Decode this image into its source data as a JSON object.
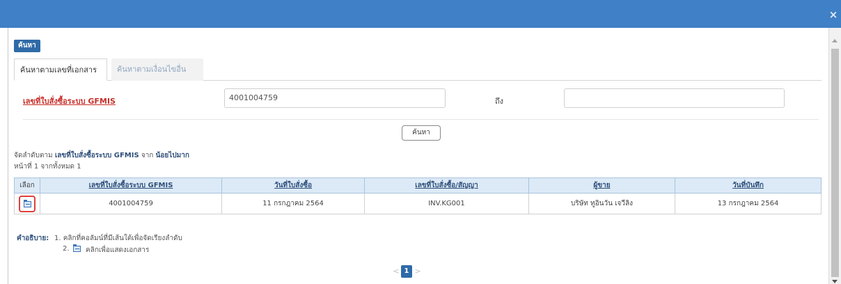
{
  "dialog": {
    "close_glyph": "×"
  },
  "search_section": {
    "tag": "ค้นหา"
  },
  "tabs": [
    {
      "label": "ค้นหาตามเลขที่เอกสาร",
      "active": true
    },
    {
      "label": "ค้นหาตามเงื่อนไขอื่น",
      "active": false
    }
  ],
  "form": {
    "field_label": "เลขที่ใบสั่งซื้อระบบ GFMIS",
    "from_value": "4001004759",
    "to_label": "ถึง",
    "to_value": "",
    "search_button": "ค้นหา"
  },
  "results": {
    "sort_prefix": "จัดลำดับตาม ",
    "sort_field": "เลขที่ใบสั่งซื้อระบบ GFMIS",
    "sort_middle": " จาก ",
    "sort_order": "น้อยไปมาก",
    "page_info": "หน้าที่ 1 จากทั้งหมด 1",
    "columns": [
      "เลือก",
      "เลขที่ใบสั่งซื้อระบบ GFMIS",
      "วันที่ใบสั่งซื้อ",
      "เลขที่ใบสั่งซื้อ/สัญญา",
      "ผู้ขาย",
      "วันที่บันทึก"
    ],
    "rows": [
      {
        "po_gfmis": "4001004759",
        "po_date": "11 กรกฎาคม 2564",
        "contract_no": "INV.KG001",
        "vendor": "บริษัท ทูอินวัน เจวีลิง",
        "record_date": "13 กรกฎาคม 2564"
      }
    ]
  },
  "legend": {
    "label": "คำอธิบาย:",
    "item1": "1. คลิกที่คอลัมน์ที่มีเส้นใต้เพื่อจัดเรียงลำดับ",
    "item2_num": "2.",
    "item2": "คลิกเพื่อแสดงเอกสาร"
  },
  "pagination": {
    "prev": "<",
    "current": "1",
    "next": ">"
  }
}
